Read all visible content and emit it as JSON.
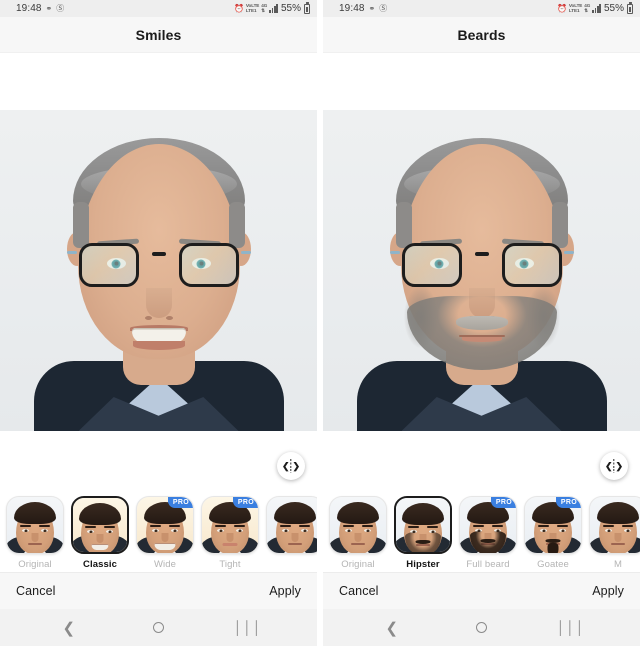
{
  "panels": [
    {
      "id": "smiles",
      "statusbar": {
        "time": "19:48",
        "left_icons": [
          "data-saver-icon",
          "dnd-icon"
        ],
        "right_icons": [
          "alarm-icon",
          "lte1-icon",
          "4g-icon",
          "signal-bars-icon",
          "battery-icon"
        ],
        "network_label_1": "VoLTE",
        "network_label_2": "LTE1",
        "network_label_3": "4G",
        "battery_percent": "55%"
      },
      "title": "Smiles",
      "compare_icon": "compare-before-after-icon",
      "thumbnails": [
        {
          "label": "Original",
          "selected": false,
          "pro": false,
          "badge": ""
        },
        {
          "label": "Classic",
          "selected": true,
          "pro": false,
          "badge": ""
        },
        {
          "label": "Wide",
          "selected": false,
          "pro": true,
          "badge": "PRO"
        },
        {
          "label": "Tight",
          "selected": false,
          "pro": true,
          "badge": "PRO"
        },
        {
          "label": "",
          "selected": false,
          "pro": false,
          "badge": ""
        }
      ],
      "actions": {
        "cancel": "Cancel",
        "apply": "Apply"
      },
      "navbar": {
        "back": "back-icon",
        "home": "home-icon",
        "recents": "recents-icon"
      }
    },
    {
      "id": "beards",
      "statusbar": {
        "time": "19:48",
        "left_icons": [
          "data-saver-icon",
          "dnd-icon"
        ],
        "right_icons": [
          "alarm-icon",
          "lte1-icon",
          "4g-icon",
          "signal-bars-icon",
          "battery-icon"
        ],
        "network_label_1": "VoLTE",
        "network_label_2": "LTE1",
        "network_label_3": "4G",
        "battery_percent": "55%"
      },
      "title": "Beards",
      "compare_icon": "compare-before-after-icon",
      "thumbnails": [
        {
          "label": "Original",
          "selected": false,
          "pro": false,
          "badge": ""
        },
        {
          "label": "Hipster",
          "selected": true,
          "pro": false,
          "badge": ""
        },
        {
          "label": "Full beard",
          "selected": false,
          "pro": true,
          "badge": "PRO"
        },
        {
          "label": "Goatee",
          "selected": false,
          "pro": true,
          "badge": "PRO"
        },
        {
          "label": "M",
          "selected": false,
          "pro": false,
          "badge": ""
        }
      ],
      "actions": {
        "cancel": "Cancel",
        "apply": "Apply"
      },
      "navbar": {
        "back": "back-icon",
        "home": "home-icon",
        "recents": "recents-icon"
      }
    }
  ],
  "colors": {
    "pro_badge": "#3a7fe0",
    "statusbar_bg": "#eeeeee",
    "titlebar_bg": "#f7f7f7",
    "navbar_bg": "#f2f2f2",
    "selected_border": "#1c1c1c",
    "label_inactive": "#b4b4b4",
    "label_active": "#141414"
  }
}
